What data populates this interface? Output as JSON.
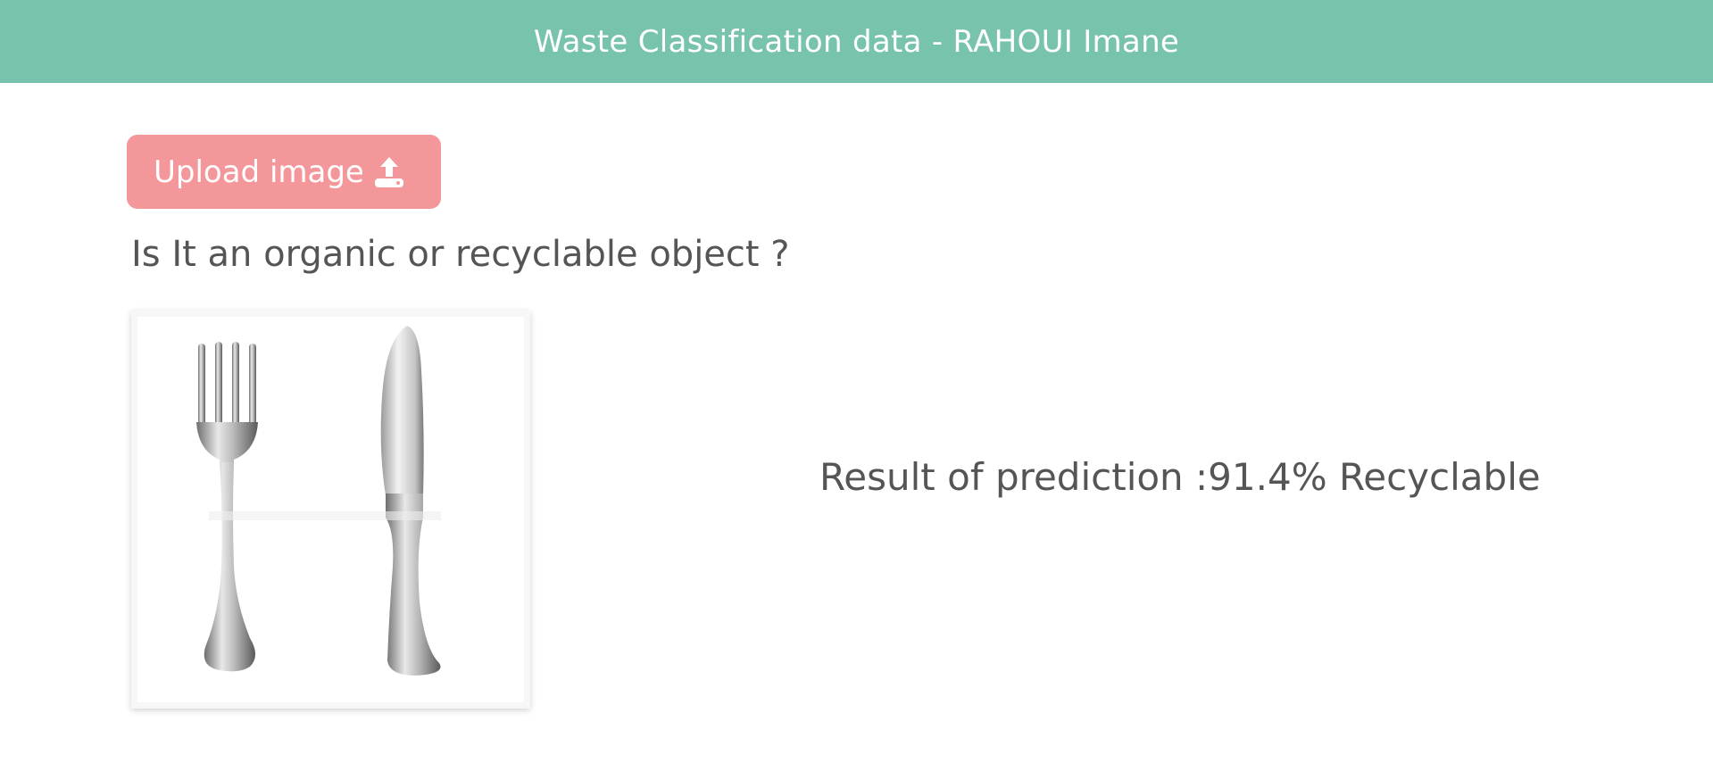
{
  "header": {
    "title": "Waste Classification data - RAHOUI Imane"
  },
  "upload": {
    "label": "Upload image",
    "icon": "upload-icon"
  },
  "question": {
    "text": "Is It an organic or recyclable object ?"
  },
  "preview": {
    "icon": "cutlery-image"
  },
  "result": {
    "text": "Result of prediction :91.4% Recyclable"
  },
  "colors": {
    "header_bg": "#77c3ad",
    "button_bg": "#f4979b",
    "text": "#555555"
  }
}
